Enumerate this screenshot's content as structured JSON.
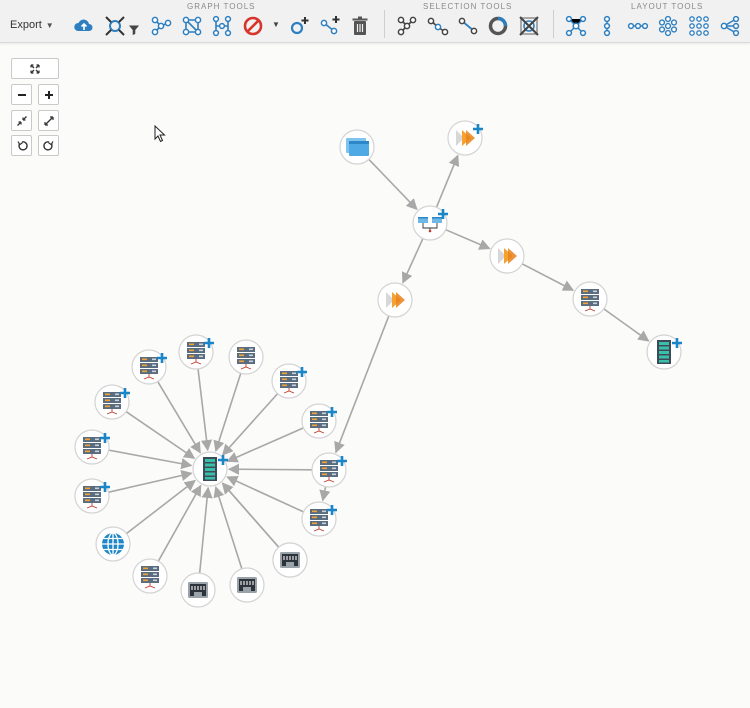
{
  "toolbar": {
    "export_label": "Export",
    "groups": [
      {
        "label": "GRAPH TOOLS"
      },
      {
        "label": "SELECTION TOOLS"
      },
      {
        "label": "LAYOUT TOOLS"
      }
    ],
    "colors": {
      "blue": "#2e7fc0",
      "red": "#d9342b",
      "gray": "#555555"
    }
  },
  "graph": {
    "edge_color": "#a8a8a8",
    "badge_color": "#1a86c8",
    "nodes": [
      {
        "id": "window",
        "icon": "window-icon"
      },
      {
        "id": "tile-top",
        "icon": "orange-tile-icon",
        "badge": true
      },
      {
        "id": "switch",
        "icon": "switch-icon",
        "badge": true
      },
      {
        "id": "tile-mid",
        "icon": "orange-tile-icon"
      },
      {
        "id": "tile-left",
        "icon": "orange-tile-icon"
      },
      {
        "id": "server-right",
        "icon": "server-icon"
      },
      {
        "id": "rack-right",
        "icon": "rack-icon",
        "badge": true
      },
      {
        "id": "hub",
        "icon": "rack-icon",
        "badge": true
      },
      {
        "id": "r1",
        "icon": "server-icon",
        "badge": true
      },
      {
        "id": "r2",
        "icon": "server-icon",
        "badge": true
      },
      {
        "id": "r3",
        "icon": "server-icon"
      },
      {
        "id": "r4",
        "icon": "server-icon",
        "badge": true
      },
      {
        "id": "r5",
        "icon": "server-icon",
        "badge": true
      },
      {
        "id": "r6",
        "icon": "server-icon",
        "badge": true
      },
      {
        "id": "r7",
        "icon": "server-icon",
        "badge": true
      },
      {
        "id": "r8",
        "icon": "server-icon"
      },
      {
        "id": "r9",
        "icon": "network-port-icon"
      },
      {
        "id": "r10",
        "icon": "network-port-icon"
      },
      {
        "id": "r11",
        "icon": "network-port-icon"
      },
      {
        "id": "r12",
        "icon": "server-icon"
      },
      {
        "id": "r13",
        "icon": "globe-icon"
      },
      {
        "id": "r14",
        "icon": "server-icon",
        "badge": true
      },
      {
        "id": "r15",
        "icon": "server-icon",
        "badge": true
      },
      {
        "id": "r16",
        "icon": "server-icon",
        "badge": true
      }
    ],
    "edges": [
      [
        "window",
        "switch"
      ],
      [
        "switch",
        "tile-top"
      ],
      [
        "switch",
        "tile-mid"
      ],
      [
        "switch",
        "tile-left"
      ],
      [
        "tile-mid",
        "server-right"
      ],
      [
        "server-right",
        "rack-right"
      ],
      [
        "tile-left",
        "r6"
      ],
      [
        "r6",
        "r7"
      ],
      [
        "r1",
        "hub"
      ],
      [
        "r2",
        "hub"
      ],
      [
        "r3",
        "hub"
      ],
      [
        "r4",
        "hub"
      ],
      [
        "r5",
        "hub"
      ],
      [
        "r6",
        "hub"
      ],
      [
        "r7",
        "hub"
      ],
      [
        "r8",
        "hub"
      ],
      [
        "r9",
        "hub"
      ],
      [
        "r10",
        "hub"
      ],
      [
        "r11",
        "hub"
      ],
      [
        "r12",
        "hub"
      ],
      [
        "r13",
        "hub"
      ],
      [
        "r14",
        "hub"
      ],
      [
        "r15",
        "hub"
      ],
      [
        "r16",
        "hub"
      ]
    ]
  }
}
